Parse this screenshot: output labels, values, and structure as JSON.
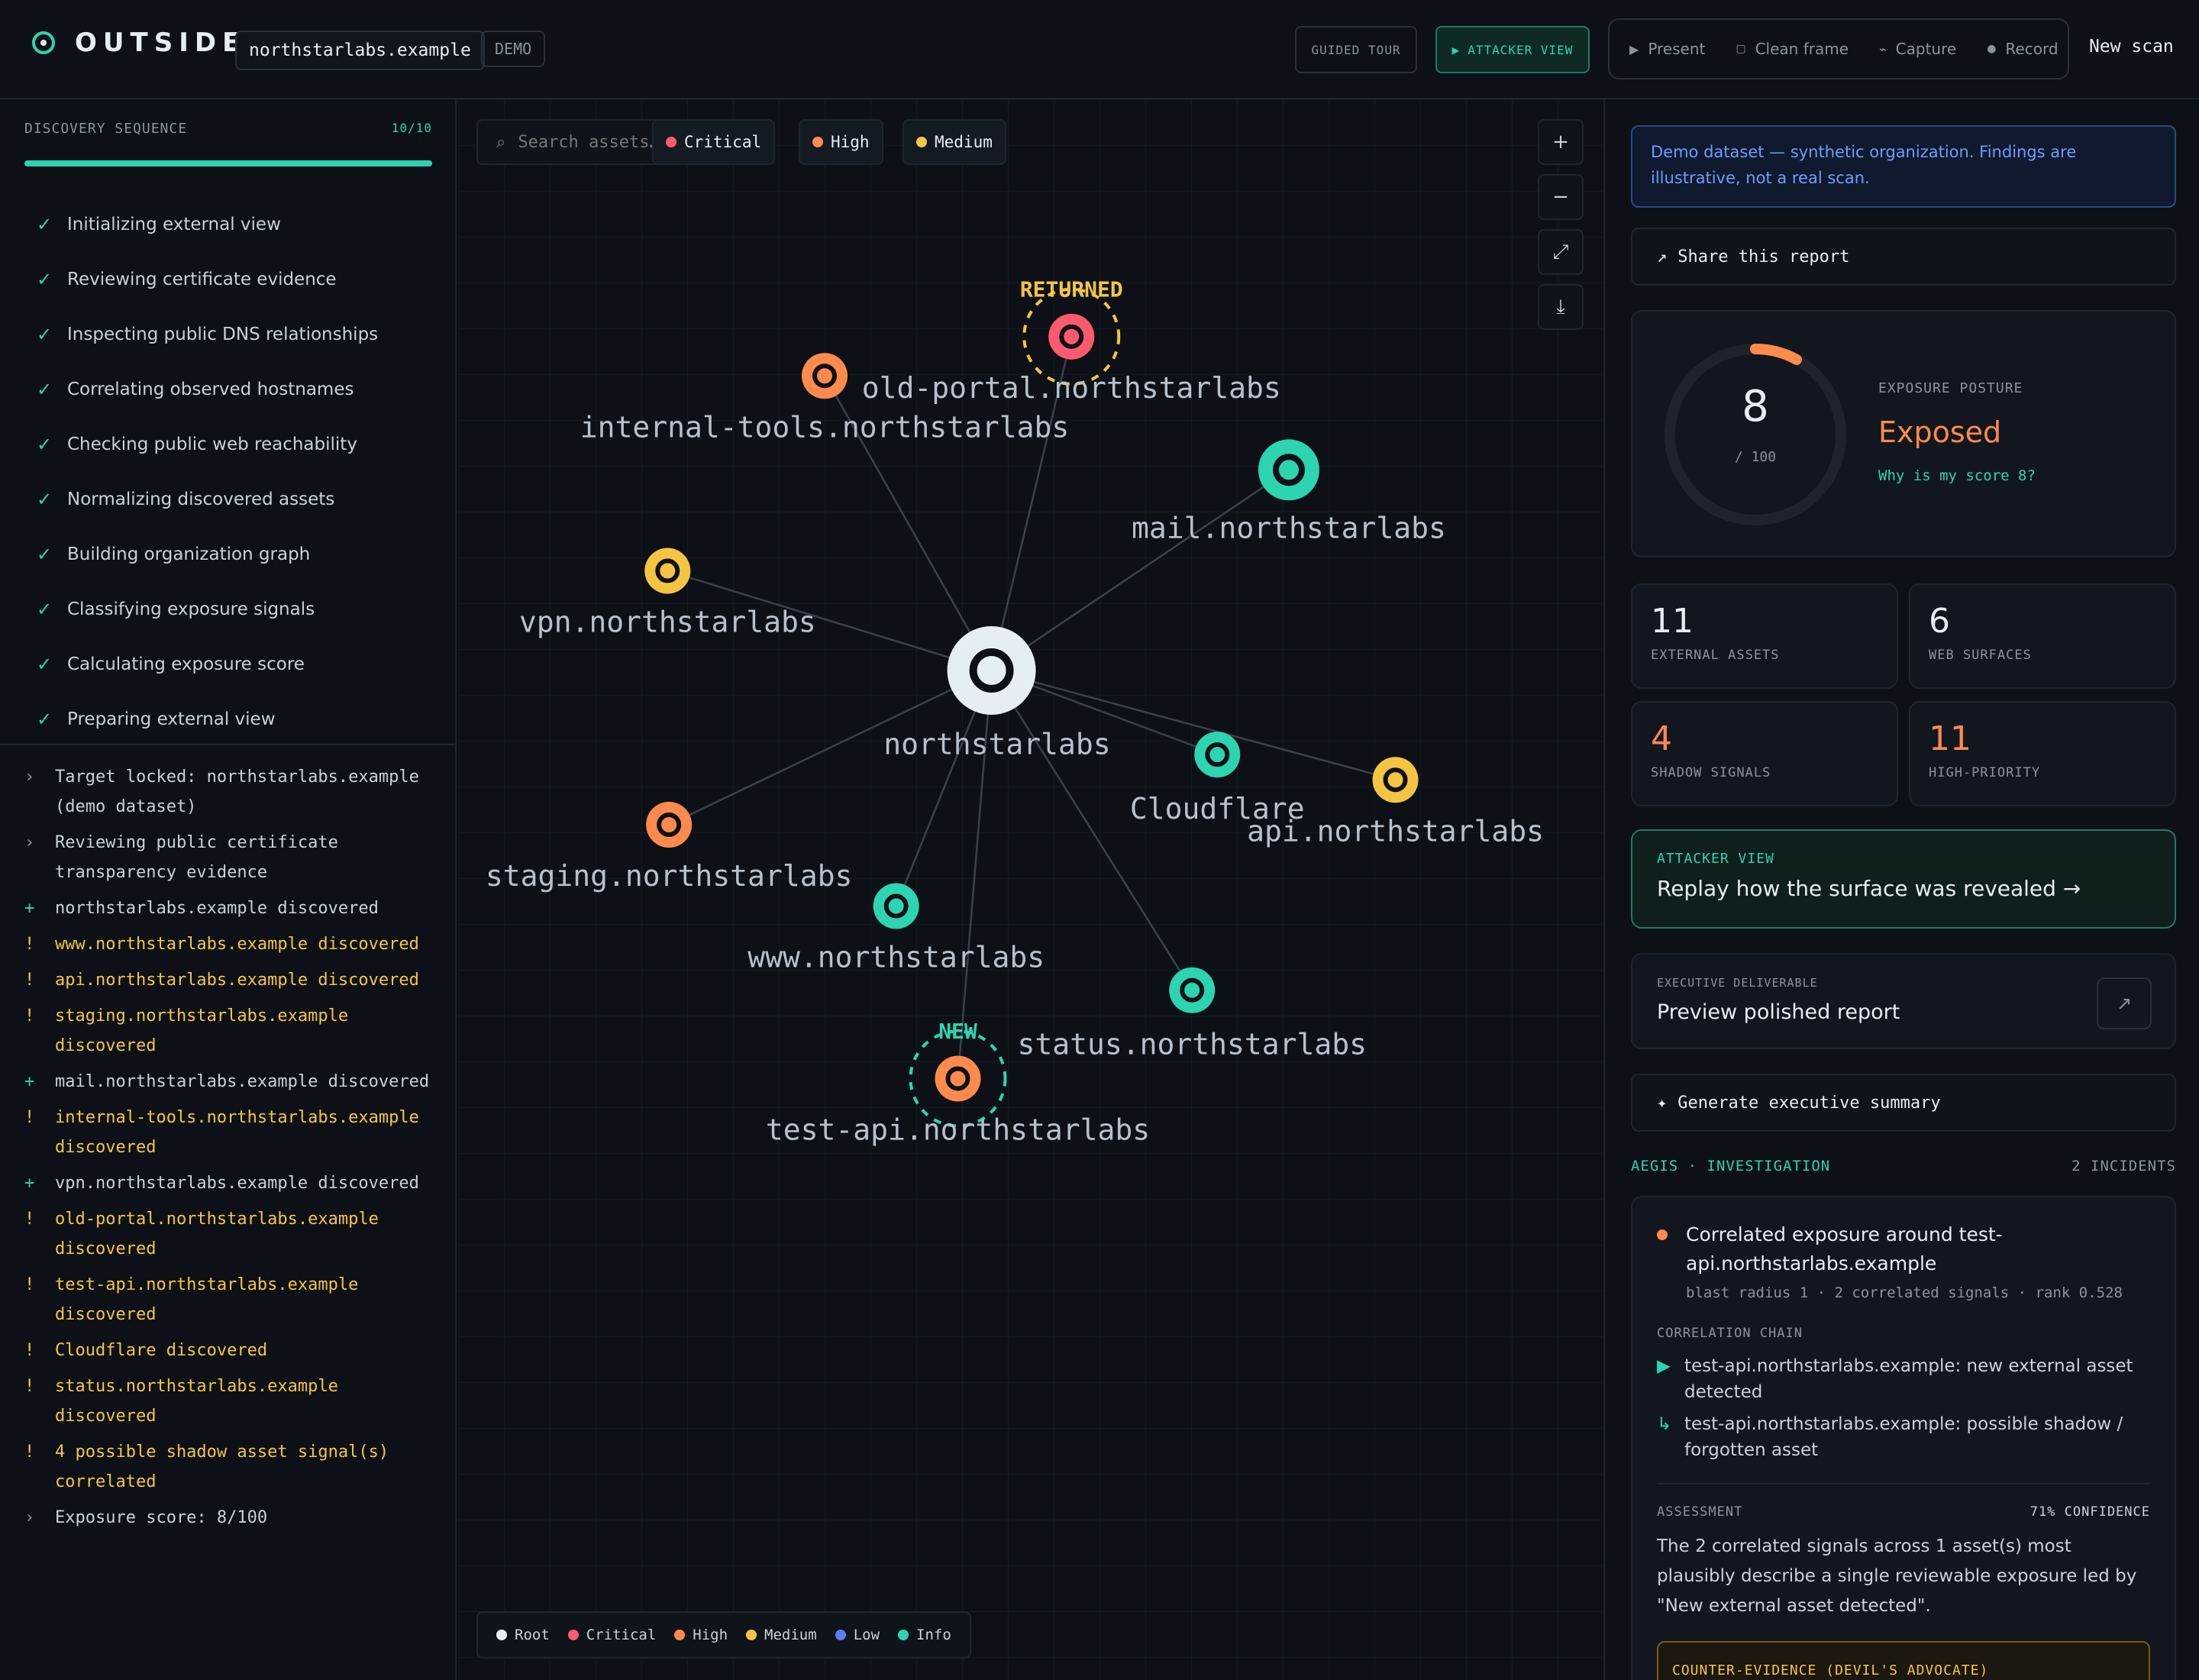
{
  "header": {
    "app_name": "OUTSIDE",
    "target_domain": "northstarlabs.example",
    "demo_label": "DEMO",
    "guided_tour": "GUIDED TOUR",
    "attacker_view": "ATTACKER VIEW",
    "present": "Present",
    "clean_frame": "Clean frame",
    "capture": "Capture",
    "record": "Record",
    "new_scan": "New scan"
  },
  "sequence": {
    "title": "DISCOVERY SEQUENCE",
    "count": "10/10",
    "progress": 1.0,
    "steps": [
      "Initializing external view",
      "Reviewing certificate evidence",
      "Inspecting public DNS relationships",
      "Correlating observed hostnames",
      "Checking public web reachability",
      "Normalizing discovered assets",
      "Building organization graph",
      "Classifying exposure signals",
      "Calculating exposure score",
      "Preparing external view"
    ]
  },
  "log": [
    {
      "type": "info",
      "text": "Target locked: northstarlabs.example (demo dataset)"
    },
    {
      "type": "info",
      "text": "Reviewing public certificate transparency evidence"
    },
    {
      "type": "add",
      "text": "northstarlabs.example discovered"
    },
    {
      "type": "warn",
      "text": "www.northstarlabs.example discovered"
    },
    {
      "type": "warn",
      "text": "api.northstarlabs.example discovered"
    },
    {
      "type": "warn",
      "text": "staging.northstarlabs.example discovered"
    },
    {
      "type": "add",
      "text": "mail.northstarlabs.example discovered"
    },
    {
      "type": "warn",
      "text": "internal-tools.northstarlabs.example discovered"
    },
    {
      "type": "add",
      "text": "vpn.northstarlabs.example discovered"
    },
    {
      "type": "warn",
      "text": "old-portal.northstarlabs.example discovered"
    },
    {
      "type": "warn",
      "text": "test-api.northstarlabs.example discovered"
    },
    {
      "type": "warn",
      "text": "Cloudflare discovered"
    },
    {
      "type": "warn",
      "text": "status.northstarlabs.example discovered"
    },
    {
      "type": "warn",
      "text": "4 possible shadow asset signal(s) correlated"
    },
    {
      "type": "info",
      "text": "Exposure score: 8/100"
    }
  ],
  "canvas": {
    "search_placeholder": "Search assets…",
    "filters": [
      {
        "label": "Critical",
        "color": "#ff5a6e"
      },
      {
        "label": "High",
        "color": "#ff8a4c"
      },
      {
        "label": "Medium",
        "color": "#f5c542"
      }
    ],
    "zoom_in": "+",
    "zoom_out": "−",
    "fit": "⤢",
    "download": "⤓",
    "legend": [
      {
        "label": "Root",
        "color": "#e6edf3"
      },
      {
        "label": "Critical",
        "color": "#ff5a6e"
      },
      {
        "label": "High",
        "color": "#ff8a4c"
      },
      {
        "label": "Medium",
        "color": "#f5c542"
      },
      {
        "label": "Low",
        "color": "#5b7cfa"
      },
      {
        "label": "Info",
        "color": "#2dd4b0"
      }
    ]
  },
  "graph": {
    "nodes": [
      {
        "id": "root",
        "label": "northstarlabs",
        "severity": "root"
      },
      {
        "id": "old-portal",
        "label": "old-portal.northstarlabs",
        "severity": "critical",
        "badge": "RETURNED"
      },
      {
        "id": "internal-tools",
        "label": "internal-tools.northstarlabs",
        "severity": "high"
      },
      {
        "id": "mail",
        "label": "mail.northstarlabs",
        "severity": "info"
      },
      {
        "id": "vpn",
        "label": "vpn.northstarlabs",
        "severity": "medium"
      },
      {
        "id": "cloudflare",
        "label": "Cloudflare",
        "severity": "info"
      },
      {
        "id": "api",
        "label": "api.northstarlabs",
        "severity": "medium"
      },
      {
        "id": "staging",
        "label": "staging.northstarlabs",
        "severity": "high"
      },
      {
        "id": "www",
        "label": "www.northstarlabs",
        "severity": "info"
      },
      {
        "id": "status",
        "label": "status.northstarlabs",
        "severity": "info"
      },
      {
        "id": "test-api",
        "label": "test-api.northstarlabs",
        "severity": "high",
        "badge": "NEW"
      }
    ],
    "colors": {
      "root": "#e6edf3",
      "critical": "#ff5a6e",
      "high": "#ff8a4c",
      "medium": "#f5c542",
      "info": "#2dd4b0",
      "returned": "#f5c542",
      "new": "#2dd4b0"
    }
  },
  "report": {
    "banner": "Demo dataset — synthetic organization. Findings are illustrative, not a real scan.",
    "share": "Share this report",
    "score": "8",
    "score_max": "/ 100",
    "score_fraction": 0.08,
    "posture_label": "EXPOSURE POSTURE",
    "posture": "Exposed",
    "why": "Why is my score 8?",
    "stats": [
      {
        "value": "11",
        "label": "EXTERNAL ASSETS"
      },
      {
        "value": "6",
        "label": "WEB SURFACES"
      },
      {
        "value": "4",
        "label": "SHADOW SIGNALS"
      },
      {
        "value": "11",
        "label": "HIGH-PRIORITY"
      }
    ],
    "attacker_label": "ATTACKER VIEW",
    "attacker_text": "Replay how the surface was revealed →",
    "exec_label": "EXECUTIVE DELIVERABLE",
    "exec_text": "Preview polished report",
    "generate": "Generate executive summary",
    "aegis": "AEGIS · INVESTIGATION",
    "incidents": "2 INCIDENTS",
    "incident": {
      "title": "Correlated exposure around test-api.northstarlabs.example",
      "meta": "blast radius 1 · 2 correlated signals · rank 0.528",
      "chain_label": "CORRELATION CHAIN",
      "chain": [
        "test-api.northstarlabs.example: new external asset detected",
        "test-api.northstarlabs.example: possible shadow / forgotten asset"
      ],
      "assessment_label": "ASSESSMENT",
      "confidence": "71% CONFIDENCE",
      "assessment": "The 2 correlated signals across 1 asset(s) most plausibly describe a single reviewable exposure led by \"New external asset detected\".",
      "counter": "COUNTER-EVIDENCE (DEVIL'S ADVOCATE)"
    }
  }
}
